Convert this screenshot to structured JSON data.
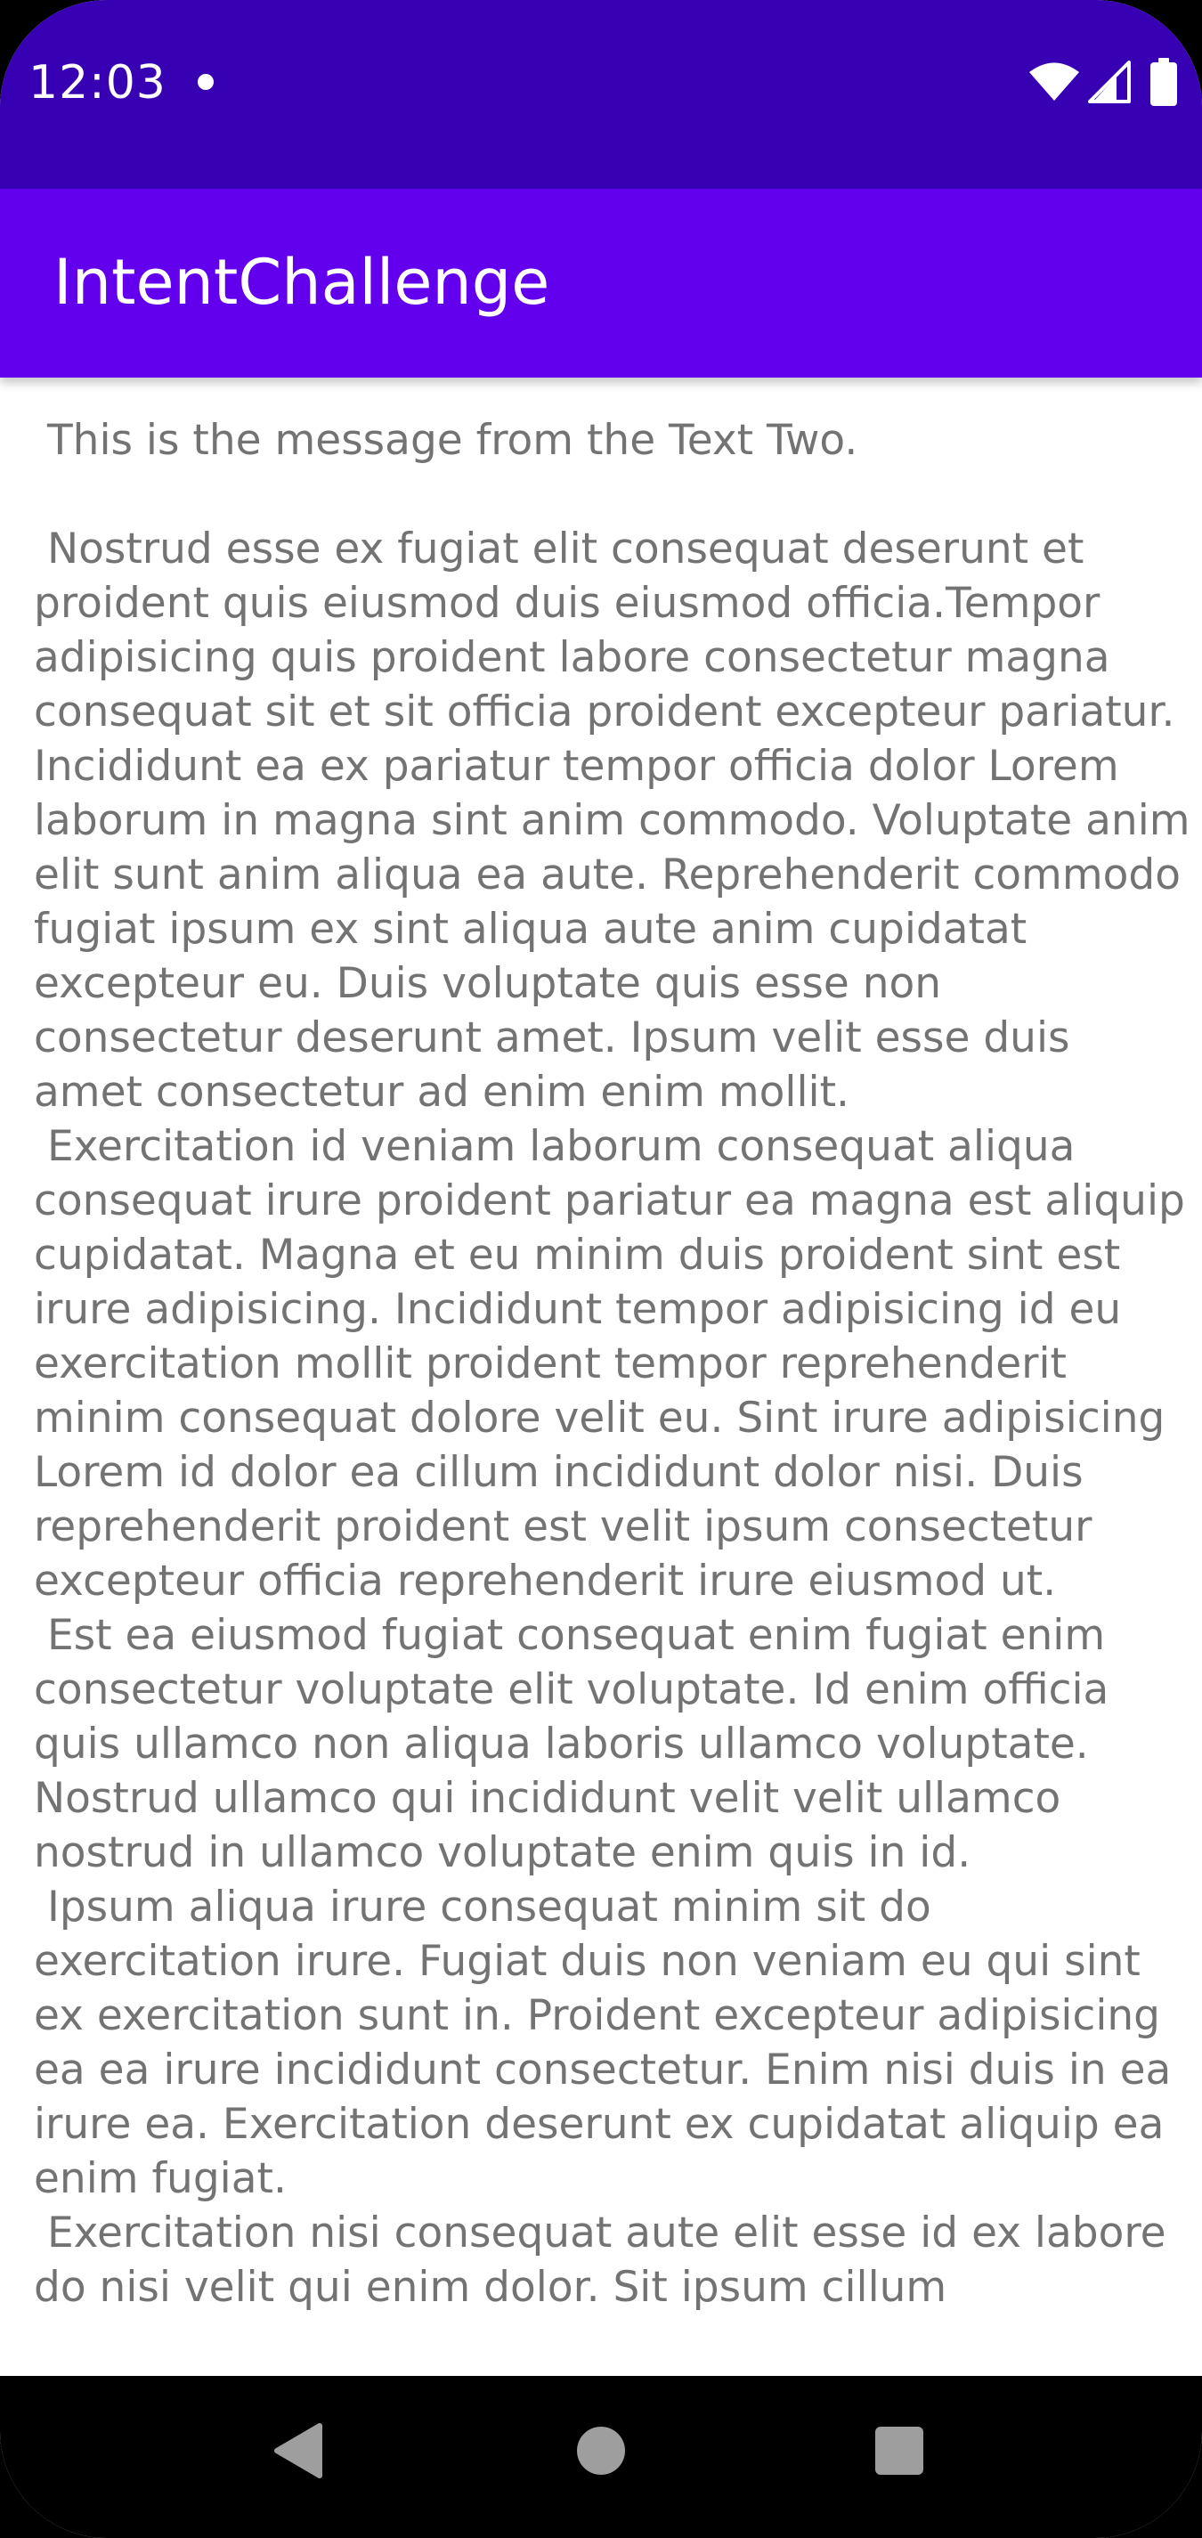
{
  "status_bar": {
    "time": "12:03",
    "icons": [
      "notification-dot-icon",
      "wifi-icon",
      "cell-signal-icon",
      "battery-icon"
    ],
    "background": "#3700b3"
  },
  "app_bar": {
    "title": "IntentChallenge",
    "background": "#6200ee"
  },
  "content": {
    "text_color": "#737373",
    "message": " This is the message from the Text Two.\n\n Nostrud esse ex fugiat elit consequat deserunt et proident quis eiusmod duis eiusmod officia.Tempor adipisicing quis proident labore consectetur magna consequat sit et sit officia proident excepteur pariatur. Incididunt ea ex pariatur tempor officia dolor Lorem laborum in magna sint anim commodo. Voluptate anim elit sunt anim aliqua ea aute. Reprehenderit commodo fugiat ipsum ex sint aliqua aute anim cupidatat excepteur eu. Duis voluptate quis esse non consectetur deserunt amet. Ipsum velit esse duis amet consectetur ad enim enim mollit.\n Exercitation id veniam laborum consequat aliqua consequat irure proident pariatur ea magna est aliquip cupidatat. Magna et eu minim duis proident sint est irure adipisicing. Incididunt tempor adipisicing id eu exercitation mollit proident tempor reprehenderit minim consequat dolore velit eu. Sint irure adipisicing Lorem id dolor ea cillum incididunt dolor nisi. Duis reprehenderit proident est velit ipsum consectetur excepteur officia reprehenderit irure eiusmod ut.\n Est ea eiusmod fugiat consequat enim fugiat enim consectetur voluptate elit voluptate. Id enim officia quis ullamco non aliqua laboris ullamco voluptate. Nostrud ullamco qui incididunt velit velit ullamco nostrud in ullamco voluptate enim quis in id.\n Ipsum aliqua irure consequat minim sit do exercitation irure. Fugiat duis non veniam eu qui sint ex exercitation sunt in. Proident excepteur adipisicing ea ea irure incididunt consectetur. Enim nisi duis in ea irure ea. Exercitation deserunt ex cupidatat aliquip ea enim fugiat.\n Exercitation nisi consequat aute elit esse id ex labore do nisi velit qui enim dolor. Sit ipsum cillum"
  },
  "nav_bar": {
    "buttons": [
      "back-icon",
      "home-icon",
      "recents-icon"
    ],
    "icon_color": "#9e9e9e"
  }
}
